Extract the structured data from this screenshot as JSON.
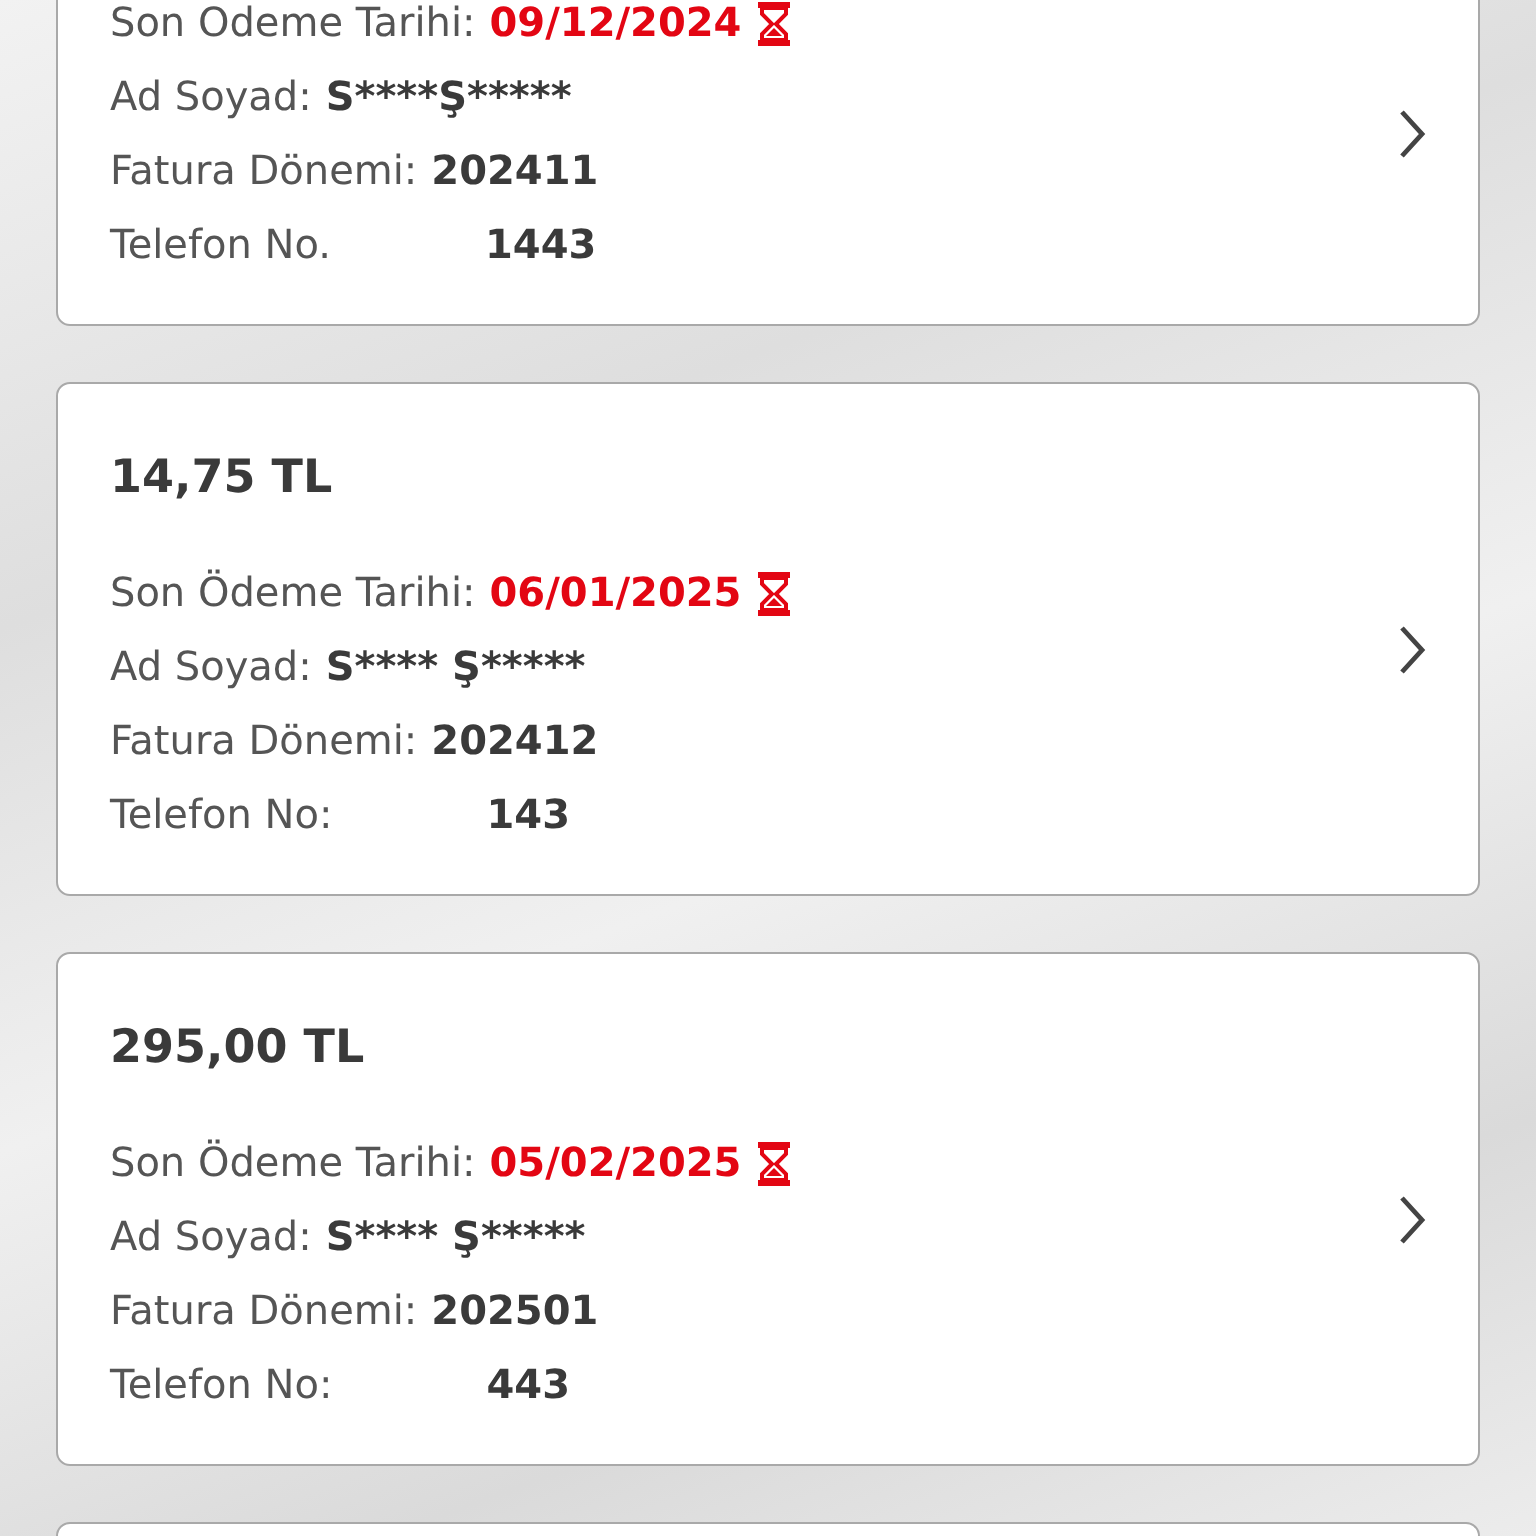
{
  "bills": [
    {
      "due_label": "Son Odeme Tarihi:",
      "due_date": "09/12/2024",
      "overdue": true,
      "name_label": "Ad Soyad:",
      "name": "S****Ş*****",
      "period_label": "Fatura Dönemi:",
      "period": "202411",
      "phone_label": "Telefon No.",
      "phone": "1443"
    },
    {
      "amount": "14,75 TL",
      "due_label": "Son Ödeme Tarihi:",
      "due_date": "06/01/2025",
      "overdue": true,
      "name_label": "Ad Soyad:",
      "name": "S**** Ş*****",
      "period_label": "Fatura Dönemi:",
      "period": "202412",
      "phone_label": "Telefon No:",
      "phone": "143"
    },
    {
      "amount": "295,00 TL",
      "due_label": "Son Ödeme Tarihi:",
      "due_date": "05/02/2025",
      "overdue": true,
      "name_label": "Ad Soyad:",
      "name": "S**** Ş*****",
      "period_label": "Fatura Dönemi:",
      "period": "202501",
      "phone_label": "Telefon No:",
      "phone": "443"
    }
  ],
  "more_below": true
}
